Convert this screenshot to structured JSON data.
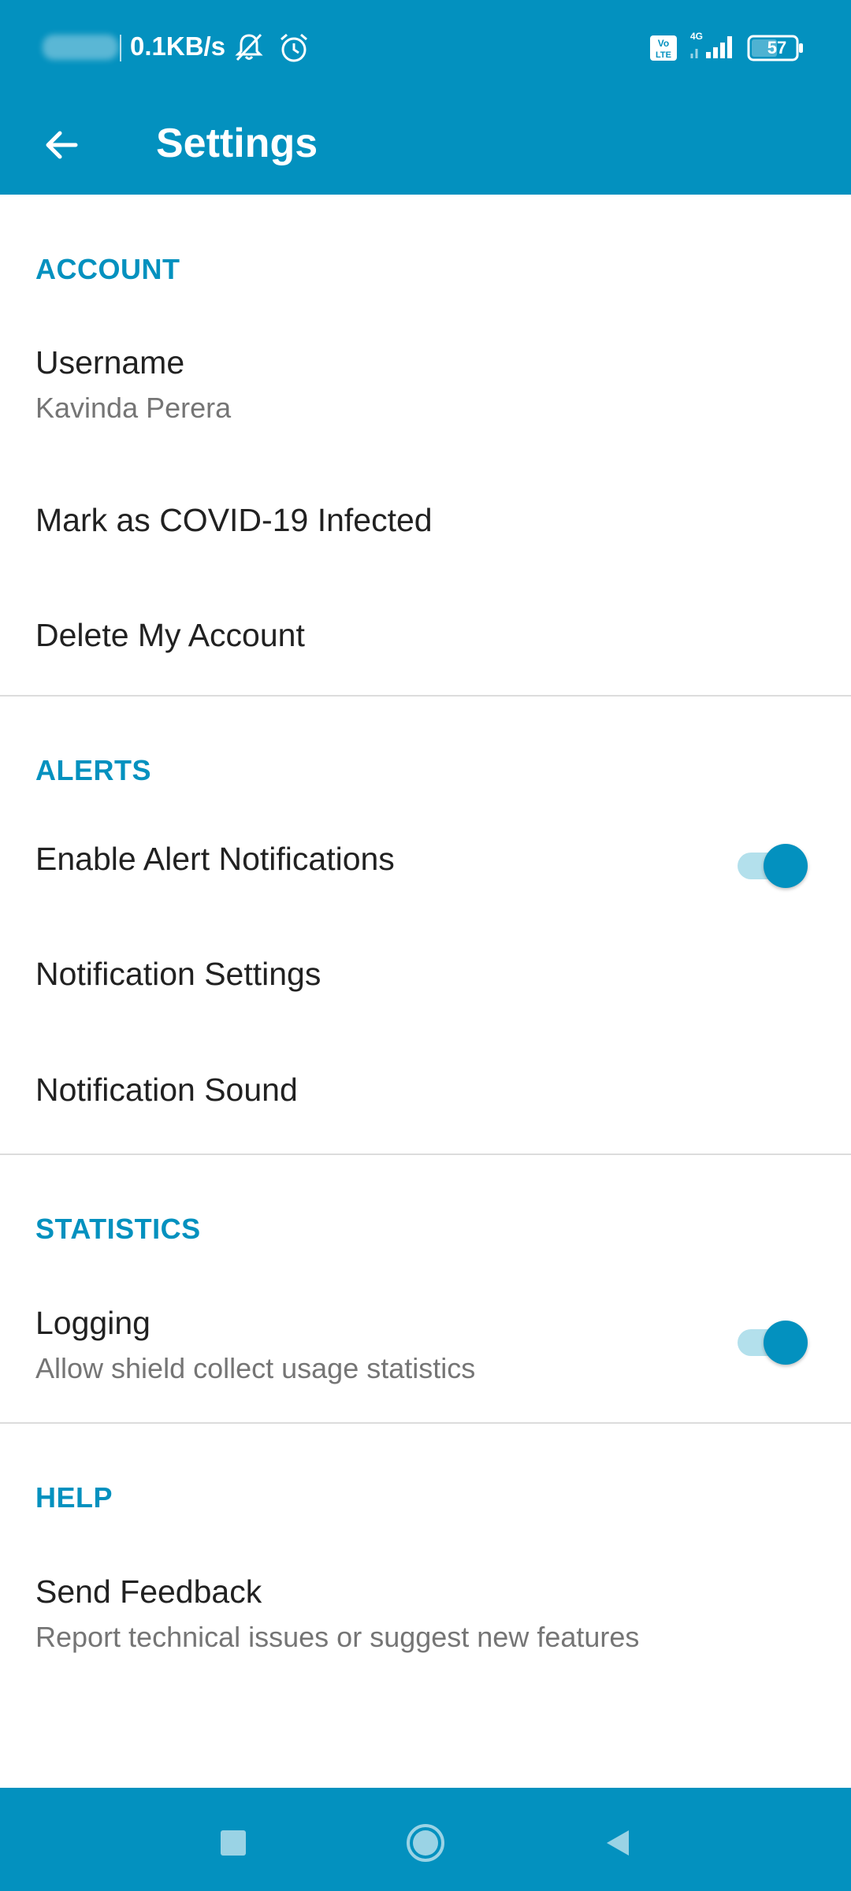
{
  "status_bar": {
    "net_speed": "0.1KB/s",
    "battery": "57",
    "network": "4G",
    "volte": "Vo LTE"
  },
  "app_bar": {
    "title": "Settings"
  },
  "sections": {
    "account": {
      "header": "ACCOUNT",
      "username_title": "Username",
      "username_value": "Kavinda Perera",
      "mark_infected": "Mark as COVID-19 Infected",
      "delete_account": "Delete My Account"
    },
    "alerts": {
      "header": "ALERTS",
      "enable_notifications": "Enable Alert Notifications",
      "enable_notifications_on": true,
      "notification_settings": "Notification Settings",
      "notification_sound": "Notification Sound"
    },
    "statistics": {
      "header": "STATISTICS",
      "logging_title": "Logging",
      "logging_summary": "Allow shield collect usage statistics",
      "logging_on": true
    },
    "help": {
      "header": "HELP",
      "feedback_title": "Send Feedback",
      "feedback_summary": "Report technical issues or suggest new features"
    }
  },
  "colors": {
    "primary": "#0391bf",
    "switch_track": "#b3e0ec",
    "divider": "#dcdcdc",
    "text_primary": "#212121",
    "text_secondary": "#757575"
  },
  "icons": {
    "back": "arrow-left-icon",
    "mute": "bell-off-icon",
    "alarm": "alarm-clock-icon",
    "signal": "signal-icon",
    "battery": "battery-icon",
    "nav_recents": "square-icon",
    "nav_home": "circle-icon",
    "nav_back": "triangle-back-icon"
  }
}
